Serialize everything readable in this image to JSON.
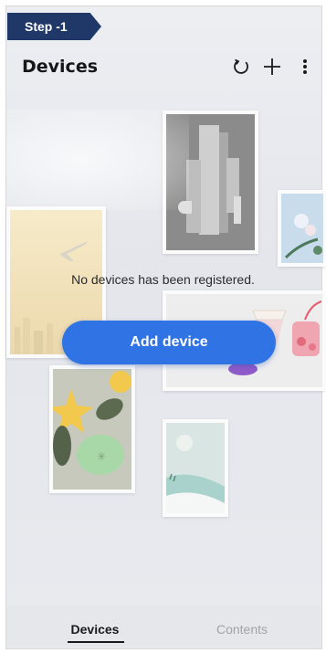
{
  "step_banner": {
    "label": "Step -1"
  },
  "header": {
    "title": "Devices",
    "icons": [
      "refresh-icon",
      "add-icon",
      "more-vertical-icon"
    ]
  },
  "main": {
    "empty_message": "No devices has been registered.",
    "add_button_label": "Add device"
  },
  "tabs": [
    {
      "label": "Devices",
      "selected": true
    },
    {
      "label": "Contents",
      "selected": false
    }
  ],
  "colors": {
    "accent": "#2f73e4",
    "banner": "#1f3868",
    "background": "#e8e9ed"
  }
}
